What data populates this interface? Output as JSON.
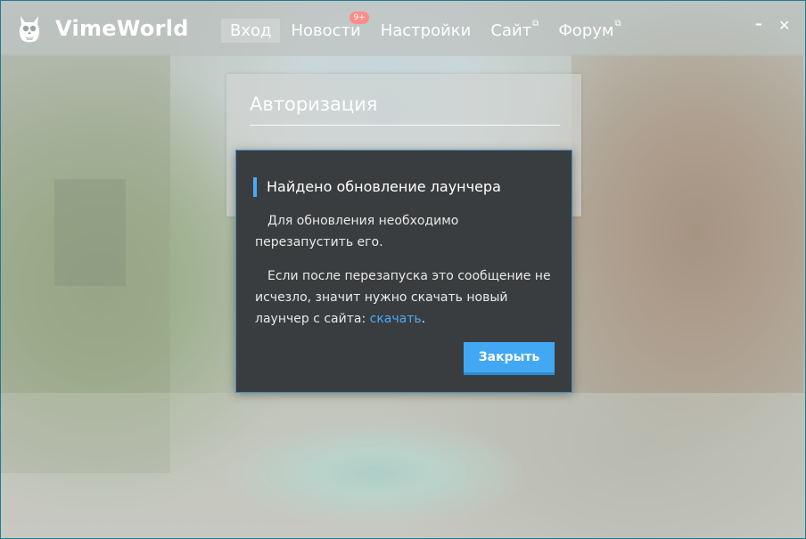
{
  "app": {
    "brand": "VimeWorld",
    "logo_icon": "owl-icon"
  },
  "nav": {
    "items": [
      {
        "label": "Вход",
        "active": true
      },
      {
        "label": "Новости",
        "badge": "9+"
      },
      {
        "label": "Настройки"
      },
      {
        "label": "Сайт",
        "icon": "external-link-icon"
      },
      {
        "label": "Форум",
        "icon": "external-link-icon"
      }
    ]
  },
  "window_controls": {
    "minimize": "–",
    "close": "✕"
  },
  "auth": {
    "title": "Авторизация"
  },
  "dialog": {
    "title": "Найдено обновление лаунчера",
    "paragraph1": "Для обновления необходимо перезапустить его.",
    "paragraph2_prefix": "Если после перезапуска это сообщение не исчезло, значит нужно скачать новый лаунчер с сайта: ",
    "paragraph2_link": "скачать",
    "paragraph2_suffix": ".",
    "close_button": "Закрыть"
  },
  "colors": {
    "accent": "#42a8f3",
    "dialog_bg": "#3a3d3f",
    "badge": "#ff8b8b"
  }
}
